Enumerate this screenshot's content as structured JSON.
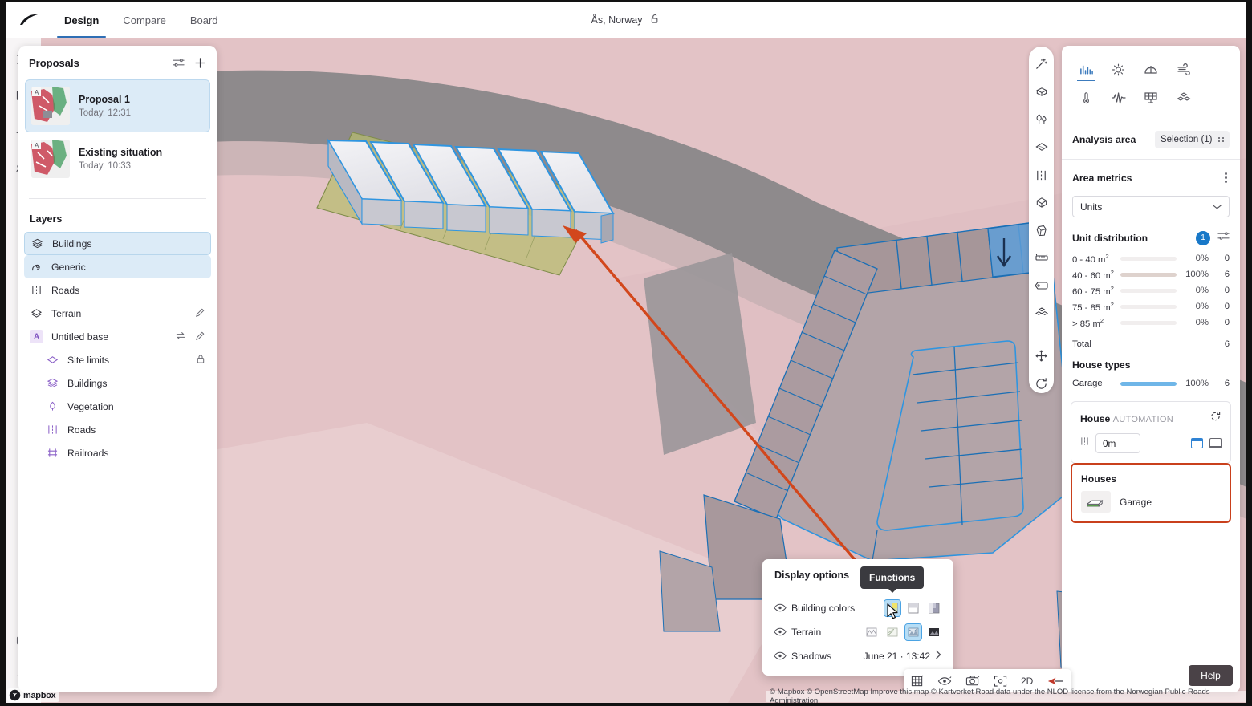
{
  "app": {
    "logo_icon": "swoosh-logo",
    "location": "Ås, Norway",
    "lock_icon": "unlock-icon"
  },
  "nav": {
    "tabs": [
      {
        "label": "Design",
        "active": true
      },
      {
        "label": "Compare",
        "active": false
      },
      {
        "label": "Board",
        "active": false
      }
    ]
  },
  "left_rail": {
    "icons": [
      "hamburger-menu-icon",
      "book-panel-icon",
      "blocks-icon",
      "people-icon"
    ],
    "bottom_icons": [
      "keyboard-icon",
      "gear-icon"
    ]
  },
  "proposals_panel": {
    "title": "Proposals",
    "header_icons": [
      "sliders-icon",
      "plus-icon"
    ],
    "items": [
      {
        "name": "Proposal 1",
        "time": "Today, 12:31",
        "badge": "A",
        "selected": true
      },
      {
        "name": "Existing situation",
        "time": "Today, 10:33",
        "badge": "A",
        "selected": false
      }
    ],
    "layers_title": "Layers",
    "layers": [
      {
        "label": "Buildings",
        "icon": "buildings-icon",
        "state": "selected-outline",
        "indent": 0,
        "actions": []
      },
      {
        "label": "Generic",
        "icon": "generic-shape-icon",
        "state": "selected-fill",
        "indent": 0,
        "actions": []
      },
      {
        "label": "Roads",
        "icon": "roads-icon",
        "state": "",
        "indent": 0,
        "actions": []
      },
      {
        "label": "Terrain",
        "icon": "terrain-icon",
        "state": "",
        "indent": 0,
        "actions": [
          "pencil-icon"
        ]
      },
      {
        "label": "Untitled base",
        "icon": "badge-a-icon",
        "state": "",
        "indent": 0,
        "actions": [
          "swap-icon",
          "pencil-icon"
        ]
      },
      {
        "label": "Site limits",
        "icon": "site-limits-icon",
        "state": "",
        "indent": 1,
        "actions": [
          "lock-icon"
        ]
      },
      {
        "label": "Buildings",
        "icon": "buildings-icon",
        "state": "",
        "indent": 1,
        "actions": []
      },
      {
        "label": "Vegetation",
        "icon": "vegetation-icon",
        "state": "",
        "indent": 1,
        "actions": []
      },
      {
        "label": "Roads",
        "icon": "roads-icon",
        "state": "",
        "indent": 1,
        "actions": []
      },
      {
        "label": "Railroads",
        "icon": "railroads-icon",
        "state": "",
        "indent": 1,
        "actions": []
      }
    ]
  },
  "tool_strip": {
    "tools": [
      "magic-wand-icon",
      "building-block-icon",
      "trees-icon",
      "terrain-plane-icon",
      "road-dashed-icon",
      "solid-cube-icon",
      "volume-cube-icon",
      "measure-icon",
      "label-tag-icon",
      "stacked-blocks-icon"
    ],
    "bottom_tools": [
      "move-icon",
      "rotate-icon"
    ]
  },
  "analysis_panel": {
    "mode_icons": [
      {
        "name": "bar-chart-icon",
        "active": true
      },
      {
        "name": "sun-icon",
        "active": false
      },
      {
        "name": "daylight-dome-icon",
        "active": false
      },
      {
        "name": "wind-icon",
        "active": false
      },
      {
        "name": "thermometer-icon",
        "active": false
      },
      {
        "name": "noise-wave-icon",
        "active": false
      },
      {
        "name": "solar-panel-icon",
        "active": false
      },
      {
        "name": "stacked-blocks-icon",
        "active": false
      }
    ],
    "analysis_area_label": "Analysis area",
    "analysis_area_value": "Selection (1)",
    "analysis_area_icon": "drag-dots-icon",
    "area_metrics_label": "Area metrics",
    "area_metrics_menu_icon": "kebab-menu-icon",
    "select_value": "Units",
    "select_icon": "chevron-down-icon",
    "unit_distribution_label": "Unit distribution",
    "unit_distribution_badge": "1",
    "unit_distribution_settings_icon": "sliders-icon",
    "unit_rows": [
      {
        "label": "0 - 40 m",
        "sup": "2",
        "pct": "0%",
        "count": "0",
        "fill": 0,
        "color": "#e8e1e0"
      },
      {
        "label": "40 - 60 m",
        "sup": "2",
        "pct": "100%",
        "count": "6",
        "fill": 100,
        "color": "#ded2cd"
      },
      {
        "label": "60 - 75 m",
        "sup": "2",
        "pct": "0%",
        "count": "0",
        "fill": 0,
        "color": "#e8e1e0"
      },
      {
        "label": "75 - 85 m",
        "sup": "2",
        "pct": "0%",
        "count": "0",
        "fill": 0,
        "color": "#e8e1e0"
      },
      {
        "label": "> 85 m",
        "sup": "2",
        "pct": "0%",
        "count": "0",
        "fill": 0,
        "color": "#e8e1e0"
      }
    ],
    "total_label": "Total",
    "total_value": "6",
    "house_types_label": "House types",
    "house_type_rows": [
      {
        "label": "Garage",
        "pct": "100%",
        "count": "6",
        "fill": 100,
        "color": "#6fb6e8"
      }
    ],
    "automation_card": {
      "title_bold": "House",
      "title_light": "AUTOMATION",
      "refresh_icon": "auto-refresh-icon",
      "handle_icon": "drag-handle-icon",
      "distance_value": "0m",
      "shape_icons": [
        "square-top-blue-icon",
        "square-bottom-gray-icon"
      ]
    },
    "houses_card": {
      "title": "Houses",
      "items": [
        {
          "name": "Garage",
          "icon": "garage-3d-icon"
        }
      ]
    }
  },
  "display_options": {
    "title": "Display options",
    "tooltip": "Functions",
    "rows": [
      {
        "label": "Building colors",
        "eye_icon": "eye-icon",
        "options": [
          {
            "name": "functions-colors-icon",
            "active": true
          },
          {
            "name": "white-gradient-icon",
            "active": false
          },
          {
            "name": "gray-split-icon",
            "active": false
          }
        ]
      },
      {
        "label": "Terrain",
        "eye_icon": "eye-icon",
        "options": [
          {
            "name": "terrain-light-icon",
            "active": false
          },
          {
            "name": "terrain-contour-icon",
            "active": false
          },
          {
            "name": "terrain-satellite-icon",
            "active": true
          },
          {
            "name": "terrain-dark-icon",
            "active": false
          }
        ]
      },
      {
        "label": "Shadows",
        "eye_icon": "eye-icon",
        "value": "June 21  ·  13:42",
        "chevron": "chevron-right-icon"
      }
    ]
  },
  "bottom_toolbar": {
    "items": [
      {
        "name": "grid-view-icon",
        "label": ""
      },
      {
        "name": "visibility-eye-icon",
        "label": ""
      },
      {
        "name": "camera-icon",
        "label": ""
      },
      {
        "name": "focus-target-icon",
        "label": ""
      },
      {
        "name": "dimension-toggle",
        "label": "2D"
      },
      {
        "name": "compass-north-icon",
        "label": ""
      }
    ]
  },
  "status_bar": {
    "attribution": "© Mapbox © OpenStreetMap Improve this map © Kartverket Road data under the NLOD license from the Norwegian Public Roads Administration.",
    "mapbox_label": "mapbox"
  },
  "help_button": {
    "label": "Help"
  },
  "scene": {
    "annotation_arrow_color": "#d2471c",
    "selected_building_outline": "#2f95e0",
    "site_limit_fill": "#b5bd6c",
    "terrain_color": "#e3c3c6",
    "road_color": "#8e8a8c"
  }
}
